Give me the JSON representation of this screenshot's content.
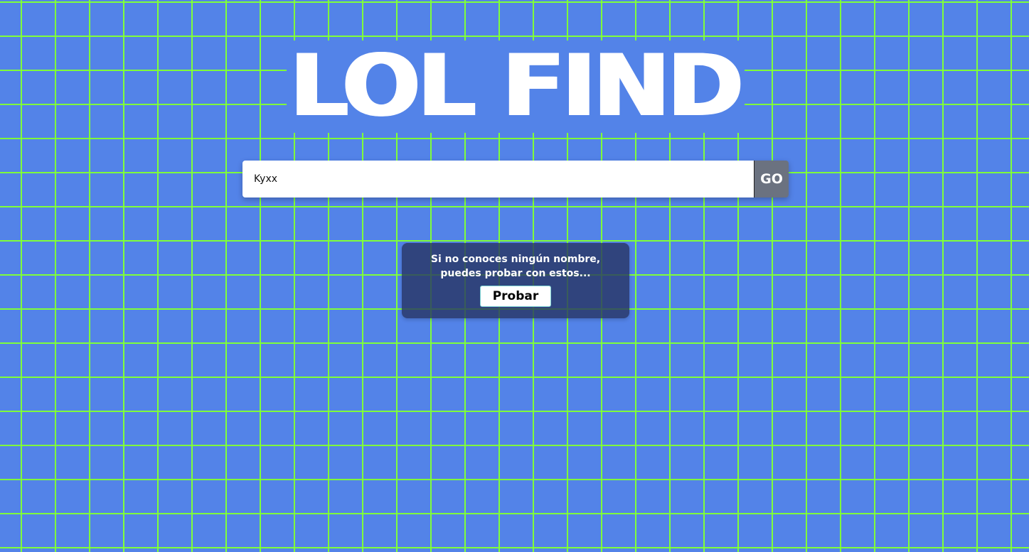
{
  "header": {
    "title": "LOL FIND"
  },
  "search": {
    "value": "Kyxx",
    "placeholder": "",
    "go_label": "GO"
  },
  "hint": {
    "text": "Si no conoces ningún nombre, puedes probar con estos...",
    "button_label": "Probar"
  },
  "colors": {
    "background": "#5383e8",
    "grid": "#7fff3a",
    "go_button": "#6b7280",
    "card": "#283462"
  }
}
